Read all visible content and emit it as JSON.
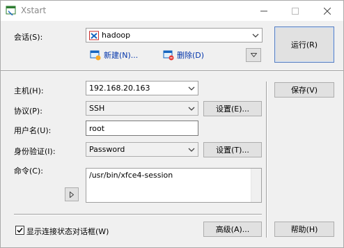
{
  "window": {
    "title": "Xstart"
  },
  "session": {
    "label": "会话(S):",
    "value": "hadoop",
    "new_label": "新建(N)...",
    "delete_label": "删除(D)"
  },
  "form": {
    "host_label": "主机(H):",
    "host_value": "192.168.20.163",
    "protocol_label": "协议(P):",
    "protocol_value": "SSH",
    "protocol_settings": "设置(E)...",
    "username_label": "用户名(U):",
    "username_value": "root",
    "auth_label": "身份验证(I):",
    "auth_value": "Password",
    "auth_settings": "设置(T)...",
    "command_label": "命令(C):",
    "command_value": "/usr/bin/xfce4-session"
  },
  "buttons": {
    "run": "运行(R)",
    "save": "保存(V)",
    "advanced": "高级(A)...",
    "help": "帮助(H)"
  },
  "footer": {
    "show_status_dialog": "显示连接状态对话框(W)",
    "show_status_checked": true
  }
}
